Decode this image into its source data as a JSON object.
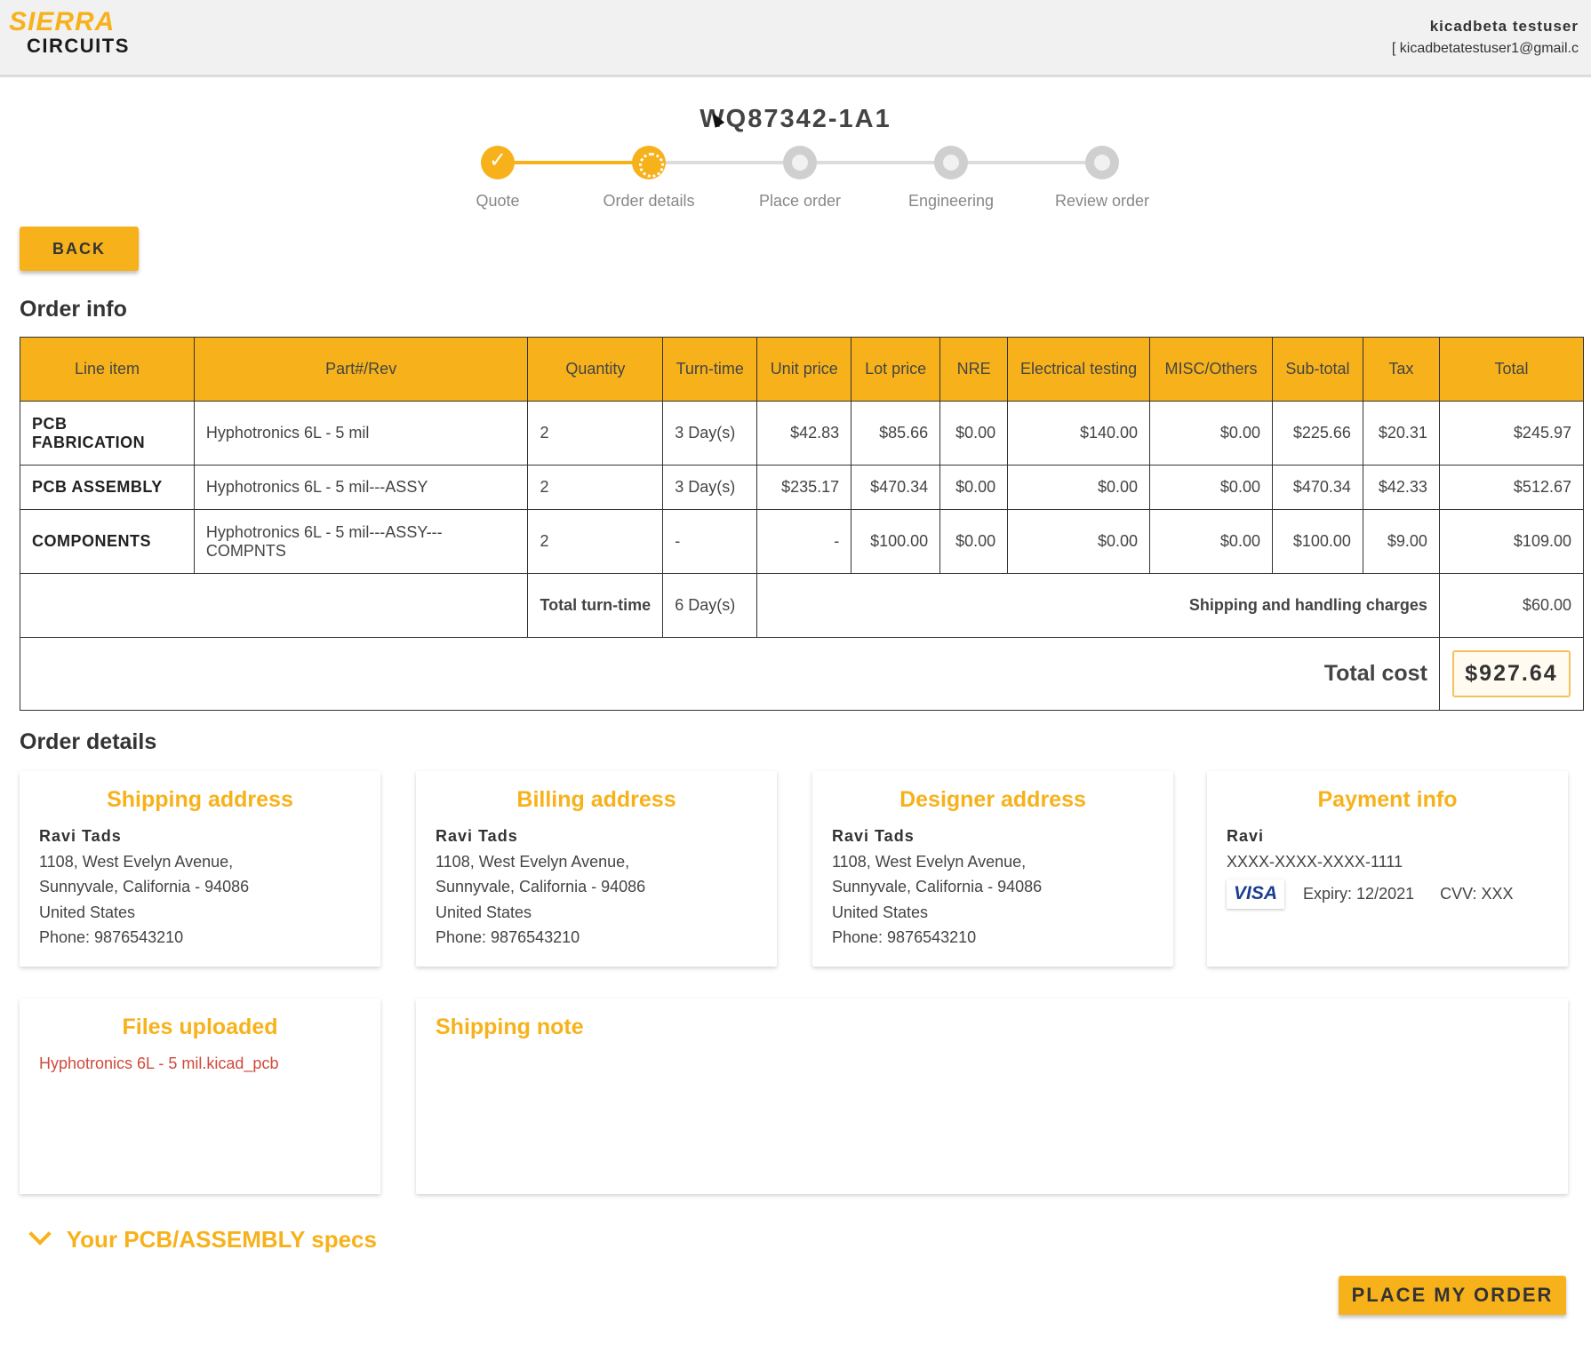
{
  "header": {
    "logo_top": "SIERRA",
    "logo_bottom": "CIRCUITS",
    "user_name": "kicadbeta testuser",
    "user_email": "[ kicadbetatestuser1@gmail.c"
  },
  "quote_id": "WQ87342-1A1",
  "stepper": {
    "steps": [
      {
        "label": "Quote",
        "state": "done"
      },
      {
        "label": "Order details",
        "state": "active"
      },
      {
        "label": "Place order",
        "state": "pending"
      },
      {
        "label": "Engineering",
        "state": "pending"
      },
      {
        "label": "Review order",
        "state": "pending"
      }
    ],
    "check_glyph": "✓"
  },
  "back_label": "BACK",
  "order_info": {
    "title": "Order info",
    "columns": [
      "Line item",
      "Part#/Rev",
      "Quantity",
      "Turn-time",
      "Unit price",
      "Lot price",
      "NRE",
      "Electrical testing",
      "MISC/Others",
      "Sub-total",
      "Tax",
      "Total"
    ],
    "rows": [
      {
        "line_item": "PCB FABRICATION",
        "part": "Hyphotronics 6L - 5 mil",
        "qty": "2",
        "turn": "3 Day(s)",
        "unit": "$42.83",
        "lot": "$85.66",
        "nre": "$0.00",
        "etest": "$140.00",
        "misc": "$0.00",
        "subtotal": "$225.66",
        "tax": "$20.31",
        "total": "$245.97"
      },
      {
        "line_item": "PCB ASSEMBLY",
        "part": "Hyphotronics 6L - 5 mil---ASSY",
        "qty": "2",
        "turn": "3 Day(s)",
        "unit": "$235.17",
        "lot": "$470.34",
        "nre": "$0.00",
        "etest": "$0.00",
        "misc": "$0.00",
        "subtotal": "$470.34",
        "tax": "$42.33",
        "total": "$512.67"
      },
      {
        "line_item": "COMPONENTS",
        "part": "Hyphotronics 6L - 5 mil---ASSY---COMPNTS",
        "qty": "2",
        "turn": "-",
        "unit": "-",
        "lot": "$100.00",
        "nre": "$0.00",
        "etest": "$0.00",
        "misc": "$0.00",
        "subtotal": "$100.00",
        "tax": "$9.00",
        "total": "$109.00"
      }
    ],
    "total_turn_label": "Total turn-time",
    "total_turn_value": "6 Day(s)",
    "shipping_label": "Shipping and handling charges",
    "shipping_value": "$60.00",
    "total_cost_label": "Total cost",
    "total_cost_value": "$927.64"
  },
  "order_details": {
    "title": "Order details",
    "shipping": {
      "title": "Shipping address",
      "name": "Ravi Tads",
      "line1": "1108, West Evelyn Avenue,",
      "line2": "Sunnyvale, California - 94086",
      "country": "United States",
      "phone": "Phone: 9876543210"
    },
    "billing": {
      "title": "Billing address",
      "name": "Ravi Tads",
      "line1": "1108, West Evelyn Avenue,",
      "line2": "Sunnyvale, California - 94086",
      "country": "United States",
      "phone": "Phone: 9876543210"
    },
    "designer": {
      "title": "Designer address",
      "name": "Ravi Tads",
      "line1": "1108, West Evelyn Avenue,",
      "line2": "Sunnyvale, California - 94086",
      "country": "United States",
      "phone": "Phone: 9876543210"
    },
    "payment": {
      "title": "Payment info",
      "name": "Ravi",
      "card": "XXXX-XXXX-XXXX-1111",
      "brand": "VISA",
      "expiry": "Expiry: 12/2021",
      "cvv": "CVV: XXX"
    },
    "files": {
      "title": "Files uploaded",
      "file": "Hyphotronics 6L - 5 mil.kicad_pcb"
    },
    "note": {
      "title": "Shipping note"
    }
  },
  "specs_label": "Your PCB/ASSEMBLY specs",
  "place_order_label": "PLACE MY ORDER",
  "colors": {
    "accent": "#f7b21b",
    "link": "#d04a3b"
  }
}
